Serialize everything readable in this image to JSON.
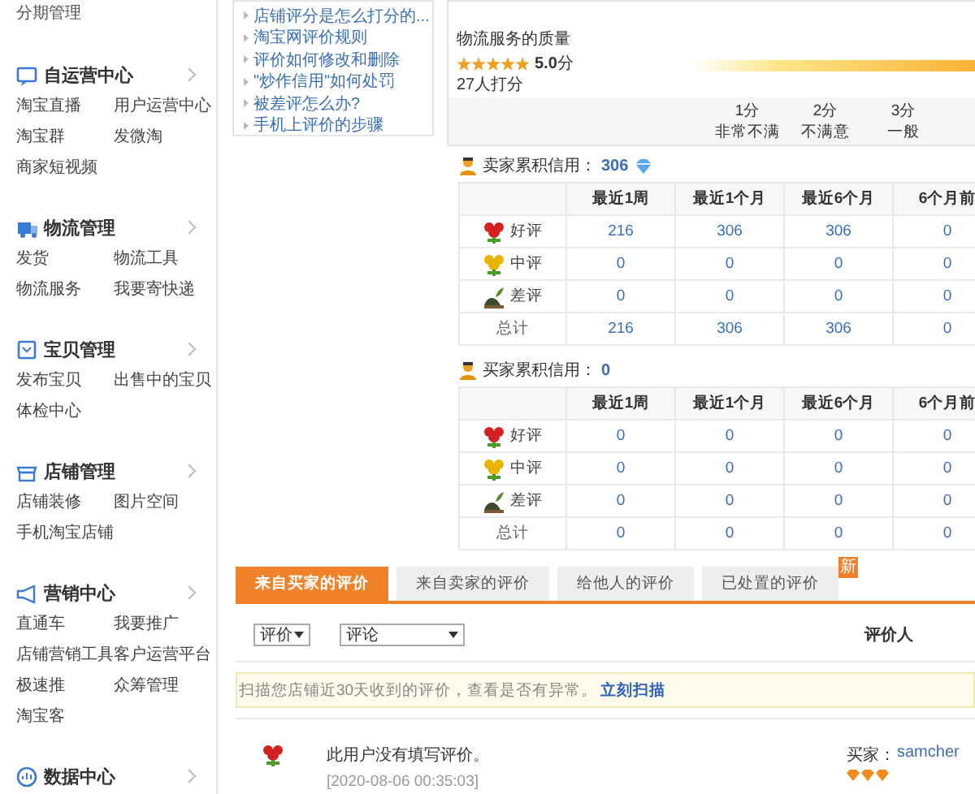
{
  "sidebar": {
    "top_item": "分期管理",
    "sections": [
      {
        "kind": "chat",
        "title": "自运营中心",
        "items": [
          "淘宝直播",
          "用户运营中心",
          "淘宝群",
          "发微淘",
          "商家短视频"
        ]
      },
      {
        "kind": "truck",
        "title": "物流管理",
        "items": [
          "发货",
          "物流工具",
          "物流服务",
          "我要寄快递"
        ]
      },
      {
        "kind": "box",
        "title": "宝贝管理",
        "items": [
          "发布宝贝",
          "出售中的宝贝",
          "体检中心"
        ]
      },
      {
        "kind": "shop",
        "title": "店铺管理",
        "items": [
          "店铺装修",
          "图片空间",
          "手机淘宝店铺"
        ]
      },
      {
        "kind": "horn",
        "title": "营销中心",
        "items": [
          "直通车",
          "我要推广",
          "店铺营销工具",
          "客户运营平台",
          "极速推",
          "众筹管理",
          "淘宝客"
        ]
      },
      {
        "kind": "chart",
        "title": "数据中心"
      }
    ]
  },
  "help_links": [
    "店铺评分是怎么打分的...",
    "淘宝网评价规则",
    "评价如何修改和删除",
    "\"炒作信用\"如何处罚",
    "被差评怎么办?",
    "手机上评价的步骤"
  ],
  "rating": {
    "title": "物流服务的质量",
    "stars": 5,
    "score": "**5.0**分",
    "raters": "27人打分",
    "scale": [
      {
        "score": "1分",
        "label": "非常不满"
      },
      {
        "score": "2分",
        "label": "不满意"
      },
      {
        "score": "3分",
        "label": "一般"
      }
    ]
  },
  "credit_sections": [
    {
      "title": "卖家累积信用：",
      "value": "306",
      "diamond": true,
      "columns": [
        "最近1周",
        "最近1个月",
        "最近6个月",
        "6个月前"
      ],
      "rows": [
        {
          "kind": "good",
          "label": "好评",
          "values": [
            "216",
            "306",
            "306",
            "0"
          ]
        },
        {
          "kind": "neutral",
          "label": "中评",
          "values": [
            "0",
            "0",
            "0",
            "0"
          ]
        },
        {
          "kind": "bad",
          "label": "差评",
          "values": [
            "0",
            "0",
            "0",
            "0"
          ]
        },
        {
          "kind": "total",
          "label": "总计",
          "values": [
            "216",
            "306",
            "306",
            "0"
          ]
        }
      ]
    },
    {
      "title": "买家累积信用：",
      "value": "0",
      "diamond": false,
      "columns": [
        "最近1周",
        "最近1个月",
        "最近6个月",
        "6个月前"
      ],
      "rows": [
        {
          "kind": "good",
          "label": "好评",
          "values": [
            "0",
            "0",
            "0",
            "0"
          ]
        },
        {
          "kind": "neutral",
          "label": "中评",
          "values": [
            "0",
            "0",
            "0",
            "0"
          ]
        },
        {
          "kind": "bad",
          "label": "差评",
          "values": [
            "0",
            "0",
            "0",
            "0"
          ]
        },
        {
          "kind": "total",
          "label": "总计",
          "values": [
            "0",
            "0",
            "0",
            "0"
          ]
        }
      ]
    }
  ],
  "tabs": [
    {
      "label": "来自买家的评价",
      "selected": true
    },
    {
      "label": "来自卖家的评价",
      "selected": false
    },
    {
      "label": "给他人的评价",
      "selected": false
    },
    {
      "label": "已处置的评价",
      "selected": false,
      "badge": "新"
    }
  ],
  "filters": [
    {
      "value": "评价"
    },
    {
      "value": "评论"
    }
  ],
  "reviewer_header": "评价人",
  "notice": {
    "text": "扫描您店铺近30天收到的评价，查看是否有异常。",
    "link": "立刻扫描"
  },
  "reviews": [
    {
      "kind": "good",
      "text": "此用户没有填写评价。",
      "date": "[2020-08-06 00:35:03]",
      "reviewer_label": "买家：",
      "reviewer": "samcher"
    }
  ]
}
